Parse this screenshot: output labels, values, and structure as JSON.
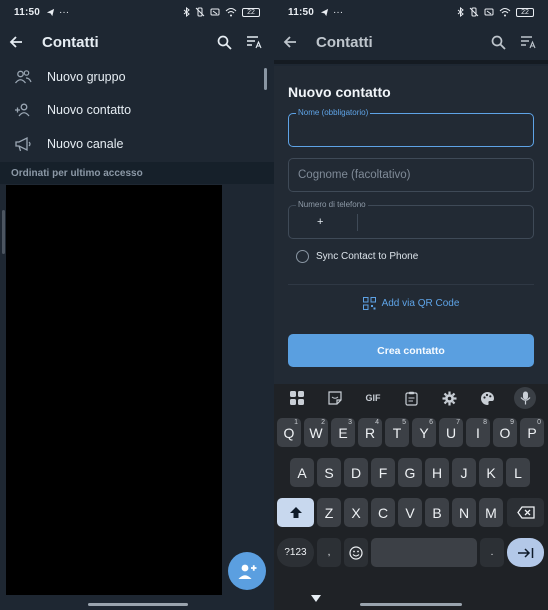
{
  "left": {
    "status": {
      "time": "11:50",
      "battery": "22"
    },
    "appbar": {
      "title": "Contatti"
    },
    "menu": [
      {
        "label": "Nuovo gruppo",
        "icon": "group-icon"
      },
      {
        "label": "Nuovo contatto",
        "icon": "add-person-icon"
      },
      {
        "label": "Nuovo canale",
        "icon": "megaphone-icon"
      }
    ],
    "section_header": "Ordinati per ultimo accesso"
  },
  "right": {
    "status": {
      "time": "11:50",
      "battery": "22"
    },
    "appbar": {
      "title": "Contatti"
    },
    "dialog": {
      "title": "Nuovo contatto",
      "first_name": {
        "label": "Nome (obbligatorio)",
        "value": ""
      },
      "last_name": {
        "placeholder": "Cognome (facoltativo)",
        "value": ""
      },
      "phone": {
        "label": "Numero di telefono",
        "prefix": "+",
        "value": ""
      },
      "sync_label": "Sync Contact to Phone",
      "sync_checked": false,
      "qr_label": "Add via QR Code",
      "create_button": "Crea contatto"
    },
    "keyboard": {
      "toolbar_gif": "GIF",
      "rows": [
        [
          {
            "k": "Q",
            "h": "1"
          },
          {
            "k": "W",
            "h": "2"
          },
          {
            "k": "E",
            "h": "3"
          },
          {
            "k": "R",
            "h": "4"
          },
          {
            "k": "T",
            "h": "5"
          },
          {
            "k": "Y",
            "h": "6"
          },
          {
            "k": "U",
            "h": "7"
          },
          {
            "k": "I",
            "h": "8"
          },
          {
            "k": "O",
            "h": "9"
          },
          {
            "k": "P",
            "h": "0"
          }
        ],
        [
          {
            "k": "A"
          },
          {
            "k": "S"
          },
          {
            "k": "D"
          },
          {
            "k": "F"
          },
          {
            "k": "G"
          },
          {
            "k": "H"
          },
          {
            "k": "J"
          },
          {
            "k": "K"
          },
          {
            "k": "L"
          }
        ],
        [
          {
            "k": "Z"
          },
          {
            "k": "X"
          },
          {
            "k": "C"
          },
          {
            "k": "V"
          },
          {
            "k": "B"
          },
          {
            "k": "N"
          },
          {
            "k": "M"
          }
        ]
      ],
      "symbols_key": "?123",
      "comma_key": ",",
      "period_key": "."
    }
  },
  "colors": {
    "accent": "#5ea3e6",
    "background": "#1e2732",
    "keyboard_bg": "#1f2226"
  }
}
